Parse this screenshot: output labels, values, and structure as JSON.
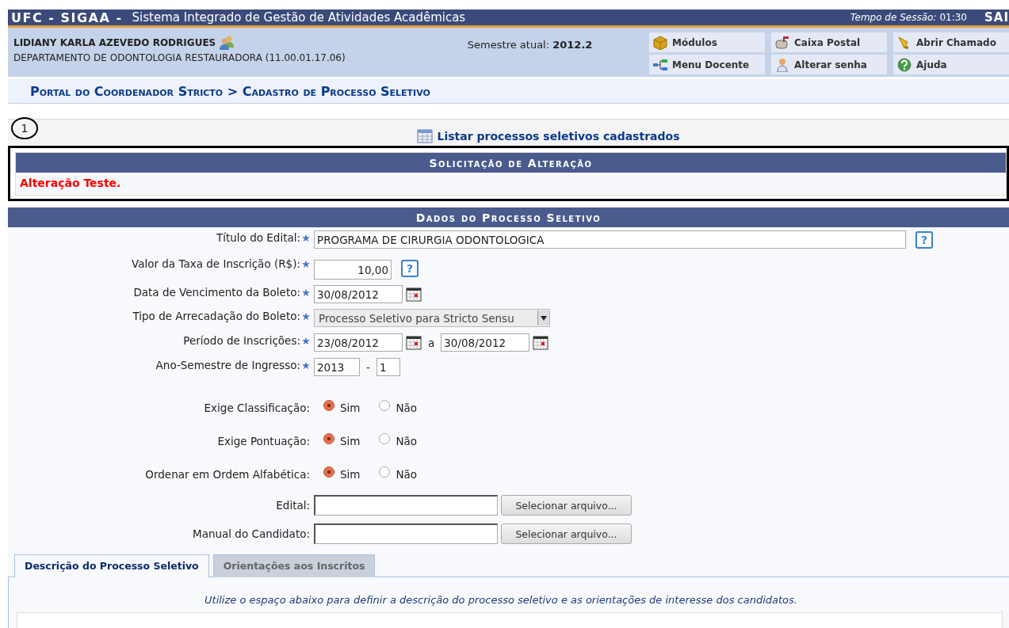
{
  "top_bar": {
    "brand": "UFC - SIGAA -",
    "system_name": "Sistema Integrado de Gestão de Atividades Acadêmicas",
    "session_label": "Tempo de Sessão:",
    "session_time": "01:30",
    "logout": "SAI"
  },
  "user": {
    "name": "LIDIANY KARLA AZEVEDO RODRIGUES",
    "unit": "DEPARTAMENTO DE ODONTOLOGIA RESTAURADORA (11.00.01.17.06)",
    "semester_label": "Semestre atual:",
    "semester": "2012.2"
  },
  "shortcuts": [
    {
      "label": "Módulos",
      "kind": "box"
    },
    {
      "label": "Caixa Postal",
      "kind": "mailbox"
    },
    {
      "label": "Abrir Chamado",
      "kind": "bell"
    },
    {
      "label": "Menu Docente",
      "kind": "tree"
    },
    {
      "label": "Alterar senha",
      "kind": "person"
    },
    {
      "label": "Ajuda",
      "kind": "help"
    }
  ],
  "breadcrumb": "Portal do Coordenador Stricto > Cadastro de Processo Seletivo",
  "annotation": "1",
  "list_link": "Listar processos seletivos cadastrados",
  "change_request": {
    "title": "Solicitação de Alteração",
    "message": "Alteração Teste."
  },
  "form": {
    "title": "Dados do Processo Seletivo",
    "fields": [
      {
        "kind": "text",
        "label": "Título do Edital:",
        "required": true,
        "value": "PROGRAMA DE CIRURGIA ODONTOLOGICA",
        "help": "?"
      },
      {
        "kind": "money",
        "label": "Valor da Taxa de Inscrição (R$):",
        "required": true,
        "value": "10,00",
        "help": "?"
      },
      {
        "kind": "date",
        "label": "Data de Vencimento da Boleto:",
        "required": true,
        "value": "30/08/2012"
      },
      {
        "kind": "select",
        "label": "Tipo de Arrecadação do Boleto:",
        "required": true,
        "value": "Processo Seletivo para Stricto Sensu"
      },
      {
        "kind": "date_range",
        "label": "Período de Inscrições:",
        "required": true,
        "value": "23/08/2012",
        "separator": "a",
        "value_end": "30/08/2012"
      },
      {
        "kind": "year_semester",
        "label": "Ano-Semestre de Ingresso:",
        "required": true,
        "value": "2013",
        "separator": "-",
        "value_end": "1"
      },
      {
        "kind": "radio",
        "label": "Exige Classificação:",
        "required": false,
        "options": [
          {
            "label": "Sim",
            "selected": true
          },
          {
            "label": "Não",
            "selected": false
          }
        ]
      },
      {
        "kind": "radio",
        "label": "Exige Pontuação:",
        "required": false,
        "options": [
          {
            "label": "Sim",
            "selected": true
          },
          {
            "label": "Não",
            "selected": false
          }
        ]
      },
      {
        "kind": "radio",
        "label": "Ordenar em Ordem Alfabética:",
        "required": false,
        "options": [
          {
            "label": "Sim",
            "selected": true
          },
          {
            "label": "Não",
            "selected": false
          }
        ]
      },
      {
        "kind": "file",
        "label": "Edital:",
        "required": false,
        "button": "Selecionar arquivo..."
      },
      {
        "kind": "file",
        "label": "Manual do Candidato:",
        "required": false,
        "button": "Selecionar arquivo..."
      }
    ]
  },
  "tabs": [
    {
      "label": "Descrição do Processo Seletivo",
      "selected": true
    },
    {
      "label": "Orientações aos Inscritos",
      "selected": false
    }
  ],
  "tab_hint": "Utilize o espaço abaixo para definir a descrição do processo seletivo e as orientações de interesse dos candidatos."
}
